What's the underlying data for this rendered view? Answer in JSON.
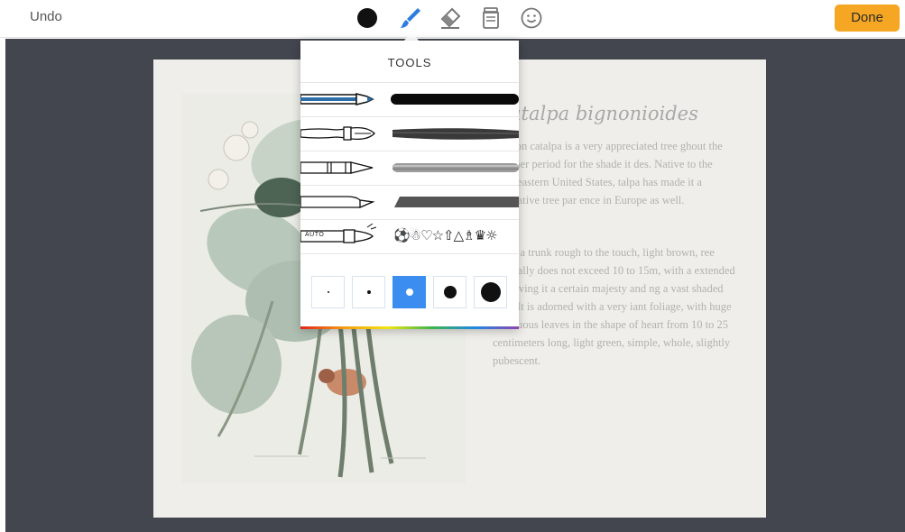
{
  "toolbar": {
    "undo_label": "Undo",
    "done_label": "Done",
    "tools": [
      "color-picker",
      "brush",
      "eraser",
      "fill-jar",
      "sticker-emoji"
    ],
    "active_tool": "brush",
    "accent_color": "#3b8ef0",
    "done_color": "#f5a623",
    "current_color": "#111111"
  },
  "popover": {
    "title": "TOOLS",
    "pens": [
      {
        "name": "marker-pen",
        "stroke": "solid"
      },
      {
        "name": "paint-brush",
        "stroke": "bristle"
      },
      {
        "name": "crayon",
        "stroke": "textured"
      },
      {
        "name": "chisel-marker",
        "stroke": "flat"
      },
      {
        "name": "auto-shape-pen",
        "label": "AUTO",
        "shapes": "⚽☃♡☆⇧△♗♛☼"
      }
    ],
    "brush_sizes": [
      "xs",
      "s",
      "m",
      "l",
      "xl"
    ],
    "selected_size": "m"
  },
  "document": {
    "title": "atalpa bignonioides",
    "paragraph1": "ommon catalpa is a very appreciated tree ghout the summer period for the shade it des. Native to the southeastern United States, talpa has made it a decorative tree par ence in Europe as well.",
    "paragraph2": "ed by a trunk rough to the touch, light brown, ree generally does not exceed 10 to 15m, with a extended top giving it a certain majesty and ng a vast shaded area. It is adorned with a very iant foliage, with huge deciduous leaves in the shape of heart from 10 to 25 centimeters long, light green, simple, whole, slightly pubescent."
  }
}
